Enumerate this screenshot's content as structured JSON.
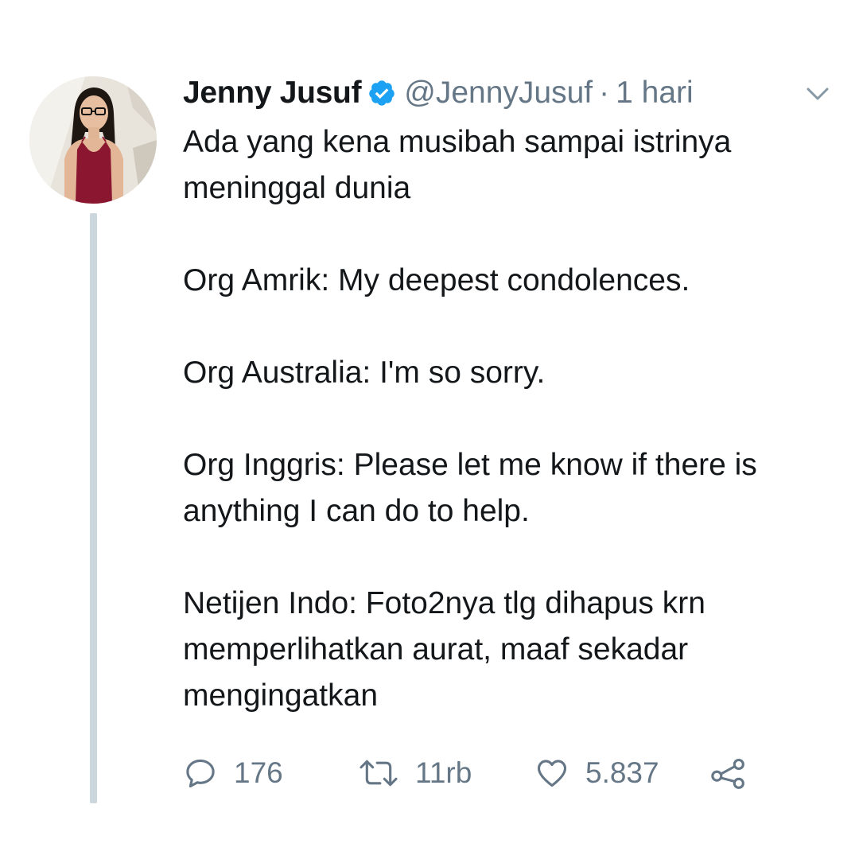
{
  "tweet": {
    "author": {
      "name": "Jenny Jusuf",
      "handle": "@JennyJusuf",
      "verified": true
    },
    "separator": "·",
    "time": "1 hari",
    "paragraphs": [
      "Ada yang kena musibah sampai istrinya meninggal dunia",
      "Org Amrik: My deepest condolences.",
      "Org Australia: I'm so sorry.",
      "Org Inggris: Please let me know if there is anything I can do to help.",
      "Netijen Indo: Foto2nya tlg dihapus krn memperlihatkan aurat, maaf sekadar mengingatkan"
    ],
    "actions": {
      "reply_count": "176",
      "retweet_count": "11rb",
      "like_count": "5.837"
    }
  },
  "colors": {
    "text": "#14171a",
    "secondary": "#657786",
    "verified_badge": "#1da1f2",
    "thread_line": "#ccd6dd"
  },
  "icons": [
    "verified-badge-icon",
    "chevron-down-icon",
    "reply-icon",
    "retweet-icon",
    "like-icon",
    "share-icon"
  ]
}
